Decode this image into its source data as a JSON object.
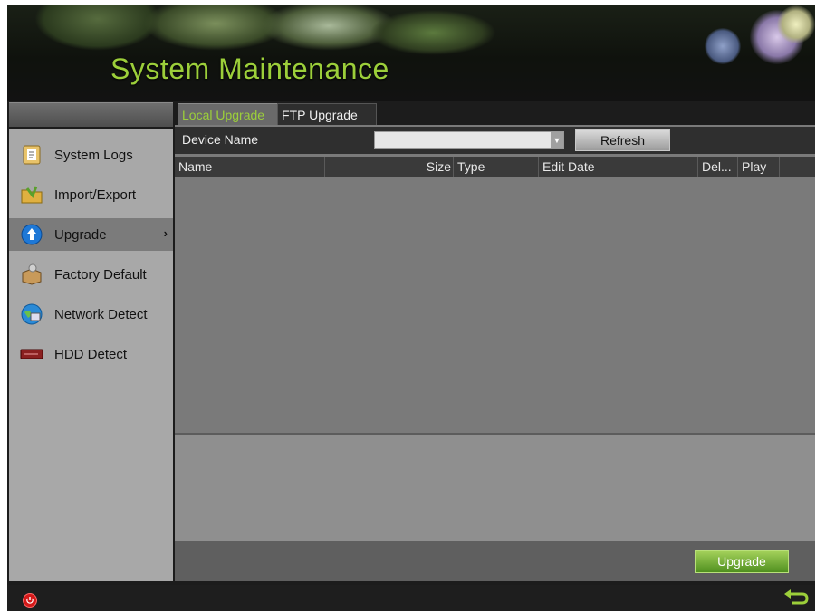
{
  "header": {
    "title": "System Maintenance"
  },
  "sidebar": {
    "items": [
      {
        "label": "System Logs",
        "icon": "document-icon",
        "active": false
      },
      {
        "label": "Import/Export",
        "icon": "folder-icon",
        "active": false
      },
      {
        "label": "Upgrade",
        "icon": "upgrade-arrow-icon",
        "active": true,
        "arrow": "›"
      },
      {
        "label": "Factory Default",
        "icon": "box-icon",
        "active": false
      },
      {
        "label": "Network Detect",
        "icon": "globe-icon",
        "active": false
      },
      {
        "label": "HDD Detect",
        "icon": "hdd-icon",
        "active": false
      }
    ]
  },
  "tabs": [
    {
      "label": "Local Upgrade",
      "active": true
    },
    {
      "label": "FTP Upgrade",
      "active": false
    }
  ],
  "device": {
    "label": "Device Name",
    "selected": ""
  },
  "refresh_label": "Refresh",
  "table": {
    "columns": [
      "Name",
      "Size",
      "Type",
      "Edit Date",
      "Del...",
      "Play"
    ]
  },
  "upgrade_label": "Upgrade",
  "colors": {
    "accent": "#9ccf3a",
    "button_green": "#6aa832",
    "power": "#d41919"
  }
}
